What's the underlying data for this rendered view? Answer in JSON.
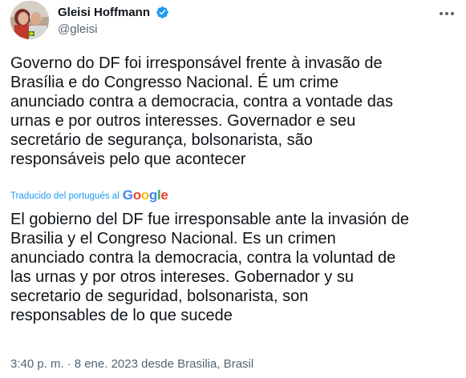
{
  "author": {
    "display_name": "Gleisi Hoffmann",
    "handle": "@gleisi",
    "verified_icon": "verified-badge-icon",
    "verified_color": "#1d9bf0"
  },
  "tweet": {
    "original_text": "Governo do DF foi irresponsável frente à invasão de\nBrasília e do Congresso Nacional. É um crime\nanunciado contra a democracia, contra a vontade das\nurnas e por outros interesses. Governador e seu\nsecretário de segurança, bolsonarista, são\nresponsáveis pelo que acontecer",
    "translation_note": "Traducido del portugués al",
    "translation_provider": [
      "G",
      "o",
      "o",
      "g",
      "l",
      "e"
    ],
    "translated_text": "El gobierno del DF fue irresponsable ante la invasión de\nBrasilia y el Congreso Nacional. Es un crimen\nanunciado contra la democracia, contra la voluntad de\nlas urnas y por otros intereses. Gobernador y su\nsecretario de seguridad, bolsonarista, son\nresponsables de lo que sucede",
    "time": "3:40 p. m.",
    "separator": "·",
    "date": "8 ene. 2023",
    "location_prefix": "desde",
    "location": "Brasilia, Brasil"
  },
  "colors": {
    "text_primary": "#0f1419",
    "text_secondary": "#536471",
    "link": "#1d9bf0"
  }
}
